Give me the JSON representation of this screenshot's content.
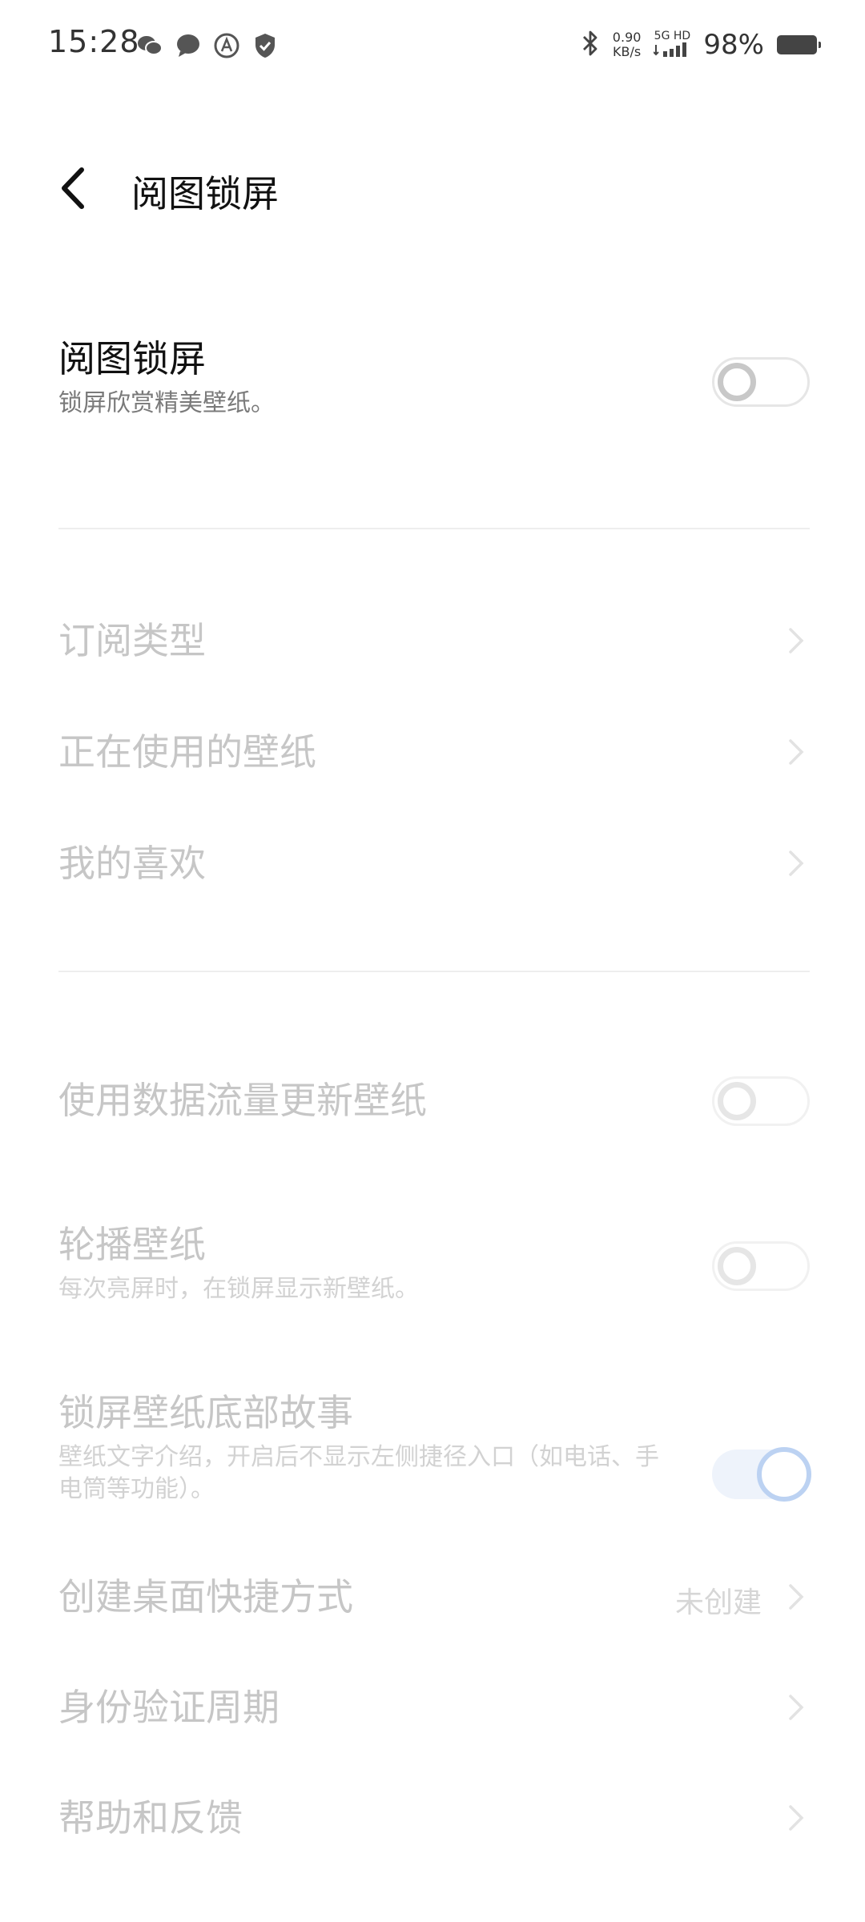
{
  "status_bar": {
    "time": "15:28",
    "net_speed_value": "0.90",
    "net_speed_unit": "KB/s",
    "signal_label": "5G HD",
    "battery_percent": "98%",
    "left_icons": [
      "wechat-icon",
      "message-icon",
      "a-icon",
      "shield-icon"
    ],
    "right_icons": [
      "bluetooth-icon",
      "signal-icon",
      "battery-icon"
    ]
  },
  "header": {
    "title": "阅图锁屏"
  },
  "main_setting": {
    "title": "阅图锁屏",
    "subtitle": "锁屏欣赏精美壁纸。",
    "toggle_on": false
  },
  "nav_items": [
    {
      "label": "订阅类型"
    },
    {
      "label": "正在使用的壁纸"
    },
    {
      "label": "我的喜欢"
    }
  ],
  "settings": {
    "data_update": {
      "title": "使用数据流量更新壁纸",
      "toggle_on": false
    },
    "carousel": {
      "title": "轮播壁纸",
      "subtitle": "每次亮屏时，在锁屏显示新壁纸。",
      "toggle_on": false
    },
    "story": {
      "title": "锁屏壁纸底部故事",
      "subtitle": "壁纸文字介绍，开启后不显示左侧捷径入口（如电话、手电筒等功能）。",
      "toggle_on": true
    },
    "shortcut": {
      "title": "创建桌面快捷方式",
      "value": "未创建"
    },
    "auth_period": {
      "title": "身份验证周期"
    },
    "help": {
      "title": "帮助和反馈"
    }
  },
  "colors": {
    "enabled_text": "#111111",
    "disabled_text": "#c6c6c6",
    "accent": "#bcd2f2"
  }
}
